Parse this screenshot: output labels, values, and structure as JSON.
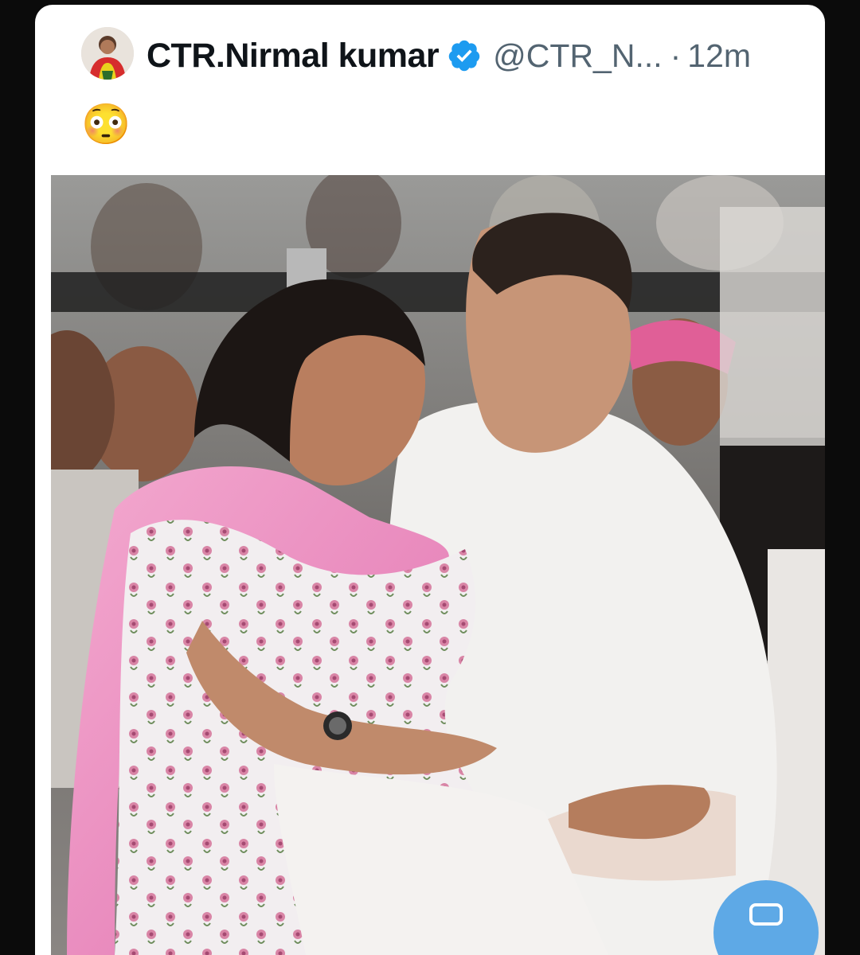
{
  "tweet": {
    "author": {
      "display_name": "CTR.Nirmal kumar",
      "handle": "@CTR_N...",
      "separator": "·",
      "time": "12m",
      "verified": true,
      "avatar_icon": "profile-photo"
    },
    "text": "😳",
    "media": {
      "type": "photo"
    }
  },
  "compose_button": {
    "icon": "compose-icon"
  },
  "colors": {
    "background": "#0b0b0b",
    "card": "#ffffff",
    "name": "#0f1419",
    "secondary_text": "#536471",
    "verified_blue": "#1d9bf0",
    "fab_blue": "#5ea9e6"
  }
}
